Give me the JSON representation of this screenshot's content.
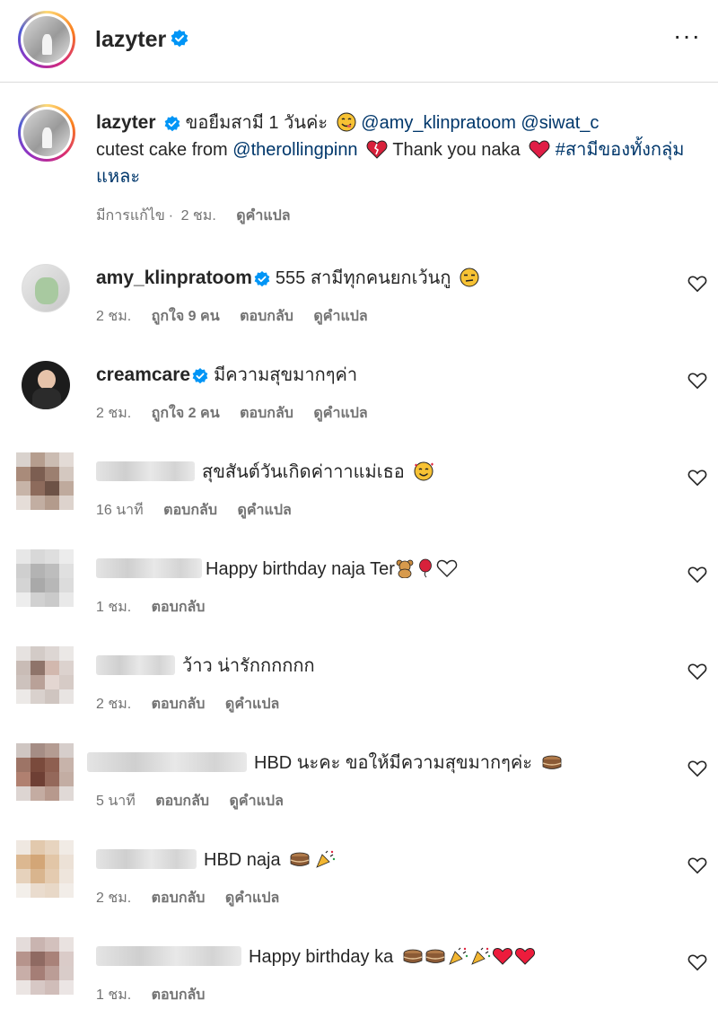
{
  "post": {
    "username": "lazyter",
    "more_label": "···"
  },
  "caption": {
    "username": "lazyter",
    "text_1": " ขอยืมสามี 1 วันค่ะ ",
    "mention_1": "@amy_klinpratoom",
    "mention_2": "@siwat_c",
    "text_2": "cutest cake from ",
    "mention_3": "@therollingpinn",
    "text_3": " Thank you naka ",
    "hashtag": "#สามีของทั้งกลุ่มแหละ",
    "edited": "มีการแก้ไข",
    "time": "2 ชม.",
    "translate": "ดูคำแปล"
  },
  "comments": [
    {
      "username": "amy_klinpratoom",
      "verified": true,
      "text": "555 สามีทุกคนยกเว้นกู",
      "emoji": "unamused-face-icon",
      "time": "2 ชม.",
      "likes": "ถูกใจ 9 คน",
      "reply": "ตอบกลับ",
      "translate": "ดูคำแปล"
    },
    {
      "username": "creamcare",
      "verified": true,
      "text": "มีความสุขมากๆค่า",
      "time": "2 ชม.",
      "likes": "ถูกใจ 2 คน",
      "reply": "ตอบกลับ",
      "translate": "ดูคำแปล"
    },
    {
      "text": "สุขสันต์วันเกิดค่าาาแม่เธอ",
      "emoji": "smiling-face-with-hearts-icon",
      "time": "16 นาที",
      "reply": "ตอบกลับ",
      "translate": "ดูคำแปล"
    },
    {
      "text": "Happy birthday naja Ter",
      "time": "1 ชม.",
      "reply": "ตอบกลับ"
    },
    {
      "text": "ว้าว น่ารักกกกกก",
      "time": "2 ชม.",
      "reply": "ตอบกลับ",
      "translate": "ดูคำแปล"
    },
    {
      "text": "HBD นะคะ ขอให้มีความสุขมากๆค่ะ",
      "time": "5 นาที",
      "reply": "ตอบกลับ",
      "translate": "ดูคำแปล"
    },
    {
      "text": "HBD naja",
      "time": "2 ชม.",
      "reply": "ตอบกลับ",
      "translate": "ดูคำแปล"
    },
    {
      "text": "Happy birthday ka",
      "time": "1 ชม.",
      "reply": "ตอบกลับ"
    }
  ],
  "colors": {
    "verified": "#0095f6",
    "link": "#00376b",
    "meta": "#737373",
    "heart_red": "#ed1c3c"
  }
}
